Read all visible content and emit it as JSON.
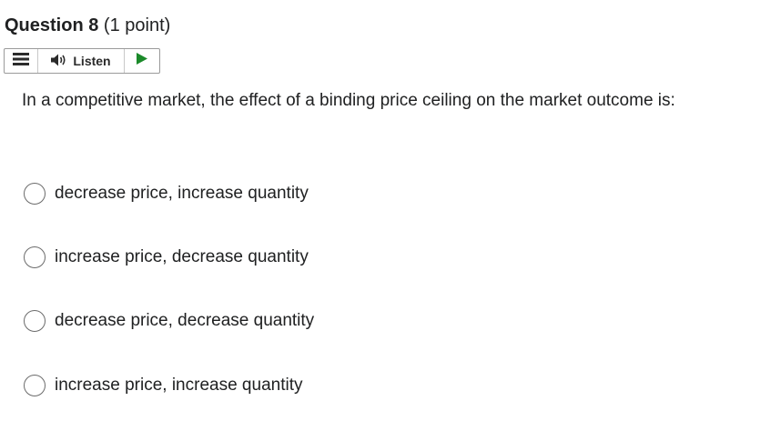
{
  "question": {
    "title": "Question 8",
    "points": "(1 point)"
  },
  "toolbar": {
    "menu_icon": "hamburger-menu-icon",
    "listen_icon": "speaker-icon",
    "listen_label": "Listen",
    "play_icon": "play-icon",
    "play_color": "#1b8a2a"
  },
  "prompt": "In a competitive market, the effect of a binding price ceiling on the market outcome is:",
  "choices": [
    {
      "label": "decrease price, increase quantity",
      "selected": false
    },
    {
      "label": "increase price, decrease quantity",
      "selected": false
    },
    {
      "label": "decrease price, decrease quantity",
      "selected": false
    },
    {
      "label": "increase price, increase quantity",
      "selected": false
    }
  ]
}
